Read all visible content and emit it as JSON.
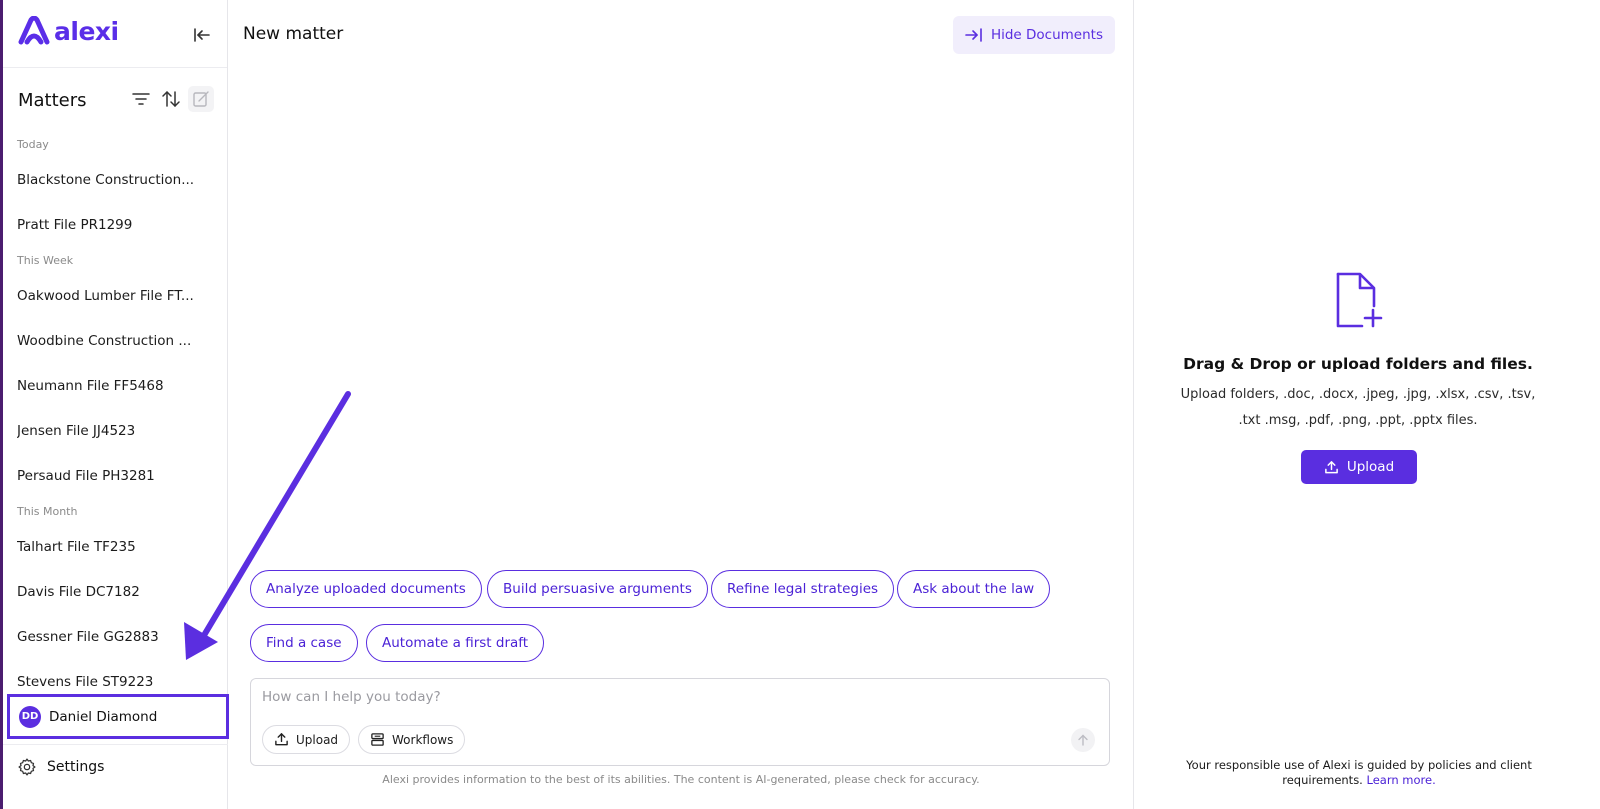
{
  "brand": {
    "name": "alexi",
    "accent": "#5a2ee0"
  },
  "sidebar": {
    "section_title": "Matters",
    "groups": [
      {
        "label": "Today",
        "items": [
          "Blackstone Construction...",
          "Pratt File PR1299"
        ]
      },
      {
        "label": "This Week",
        "items": [
          "Oakwood Lumber File FT...",
          "Woodbine Construction ...",
          "Neumann File FF5468",
          "Jensen File JJ4523",
          "Persaud File PH3281"
        ]
      },
      {
        "label": "This Month",
        "items": [
          "Talhart File TF235",
          "Davis File DC7182",
          "Gessner File GG2883",
          "Stevens File ST9223"
        ]
      }
    ],
    "user": {
      "initials": "DD",
      "name": "Daniel Diamond"
    },
    "settings_label": "Settings"
  },
  "main": {
    "title": "New matter",
    "hide_documents_label": "Hide Documents",
    "suggestions": [
      "Analyze uploaded documents",
      "Build persuasive arguments",
      "Refine legal strategies",
      "Ask about the law",
      "Find a case",
      "Automate a first draft"
    ],
    "composer": {
      "placeholder": "How can I help you today?",
      "upload_label": "Upload",
      "workflows_label": "Workflows"
    },
    "disclaimer": "Alexi provides information to the best of its abilities. The content is AI-generated, please check for accuracy."
  },
  "documents_panel": {
    "title": "Drag & Drop or upload folders and files.",
    "subtitle": "Upload folders, .doc, .docx, .jpeg, .jpg, .xlsx, .csv, .tsv, .txt .msg, .pdf, .png, .ppt, .pptx files.",
    "upload_label": "Upload",
    "policy_text": "Your responsible use of Alexi is guided by policies and client requirements.",
    "learn_more": "Learn more."
  },
  "icons": [
    "alexi-logo-icon",
    "collapse-sidebar-icon",
    "filter-icon",
    "sort-icon",
    "new-matter-icon",
    "settings-gear-icon",
    "hide-documents-icon",
    "upload-icon",
    "workflows-icon",
    "send-arrow-icon",
    "document-add-icon"
  ]
}
